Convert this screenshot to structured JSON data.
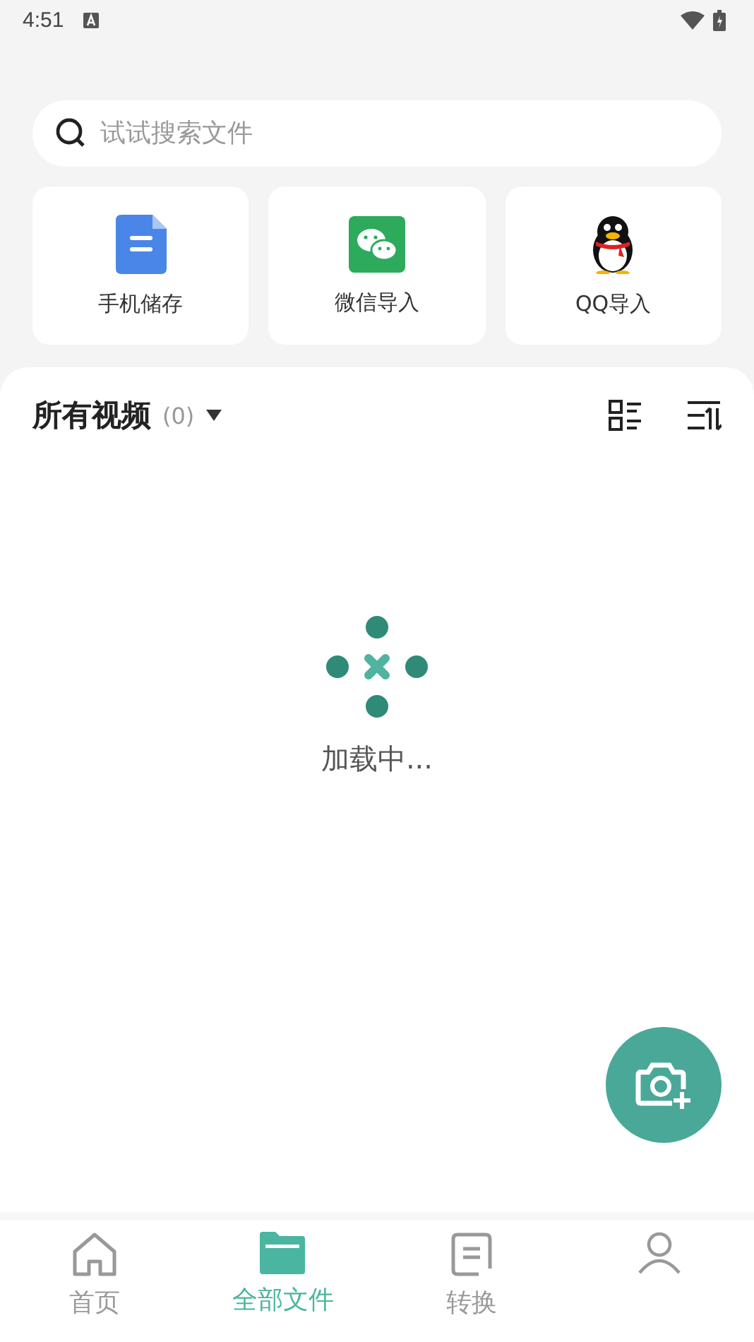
{
  "status_bar": {
    "time": "4:51"
  },
  "search": {
    "placeholder": "试试搜索文件"
  },
  "sources": [
    {
      "kind": "storage",
      "label": "手机储存"
    },
    {
      "kind": "wechat",
      "label": "微信导入"
    },
    {
      "kind": "qq",
      "label": "QQ导入"
    }
  ],
  "section": {
    "title": "所有视频",
    "count": "(0)"
  },
  "loading": {
    "text": "加载中..."
  },
  "nav": [
    {
      "kind": "home",
      "label": "首页",
      "selected": false
    },
    {
      "kind": "files",
      "label": "全部文件",
      "selected": true
    },
    {
      "kind": "convert",
      "label": "转换",
      "selected": false
    },
    {
      "kind": "profile",
      "selected": false
    }
  ]
}
